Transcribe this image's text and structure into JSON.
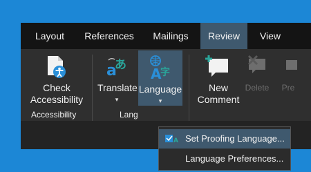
{
  "tabs": [
    {
      "label": "Layout"
    },
    {
      "label": "References"
    },
    {
      "label": "Mailings"
    },
    {
      "label": "Review",
      "active": true
    },
    {
      "label": "View"
    }
  ],
  "ribbon": {
    "check_accessibility_line1": "Check",
    "check_accessibility_line2": "Accessibility",
    "accessibility_group": "Accessibility",
    "translate": "Translate",
    "language": "Language",
    "language_group": "Lang",
    "new_comment_line1": "New",
    "new_comment_line2": "Comment",
    "delete": "Delete",
    "previous_partial": "Pre"
  },
  "menu": {
    "set_proofing_language": "Set Proofing Language...",
    "language_preferences": "Language Preferences..."
  },
  "colors": {
    "background": "#1c87d6",
    "accent": "#3f596e",
    "teal": "#2aa59a"
  }
}
